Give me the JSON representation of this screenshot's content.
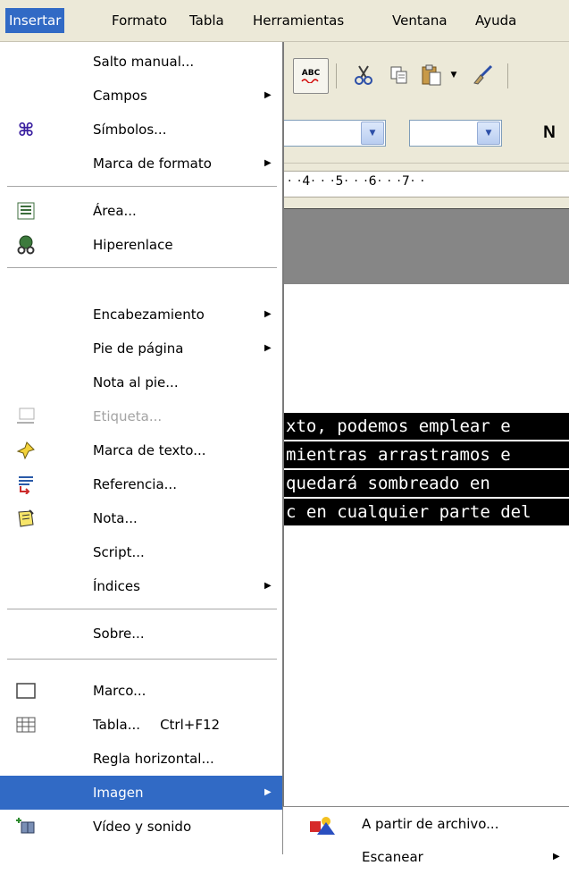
{
  "menubar": {
    "items": [
      {
        "label": "Insertar",
        "active": true
      },
      {
        "label": "Formato",
        "active": false
      },
      {
        "label": "Tabla",
        "active": false
      },
      {
        "label": "Herramientas",
        "active": false
      },
      {
        "label": "Ventana",
        "active": false
      },
      {
        "label": "Ayuda",
        "active": false
      }
    ]
  },
  "toolbar": {
    "spellcheck_icon_text": "ABC",
    "bold_label": "N"
  },
  "ruler": {
    "text": "· ·4· · ·5· · ·6· · ·7· ·"
  },
  "document": {
    "selected_lines": [
      "xto, podemos emplear e",
      " mientras arrastramos e",
      "quedará sombreado en",
      "c en cualquier parte del"
    ]
  },
  "insert_menu": {
    "items": {
      "salto_manual": "Salto manual...",
      "campos": "Campos",
      "simbolos": "Símbolos...",
      "marca_formato": "Marca de formato",
      "area": "Área...",
      "hiperenlace": "Hiperenlace",
      "encabezamiento": "Encabezamiento",
      "pie_pagina": "Pie de página",
      "nota_pie": "Nota al pie...",
      "etiqueta": "Etiqueta...",
      "marca_texto": "Marca de texto...",
      "referencia": "Referencia...",
      "nota": "Nota...",
      "script": "Script...",
      "indices": "Índices",
      "sobre": "Sobre...",
      "marco": "Marco...",
      "tabla": "Tabla...",
      "tabla_shortcut": "Ctrl+F12",
      "regla_horizontal": "Regla horizontal...",
      "imagen": "Imagen",
      "video_sonido": "Vídeo y sonido"
    },
    "highlighted": "Imagen"
  },
  "image_submenu": {
    "a_partir_archivo": "A partir de archivo...",
    "escanear": "Escanear"
  },
  "colors": {
    "menubar_bg": "#ece9d8",
    "highlight": "#316ac5",
    "disabled_text": "#a3a3a3"
  }
}
